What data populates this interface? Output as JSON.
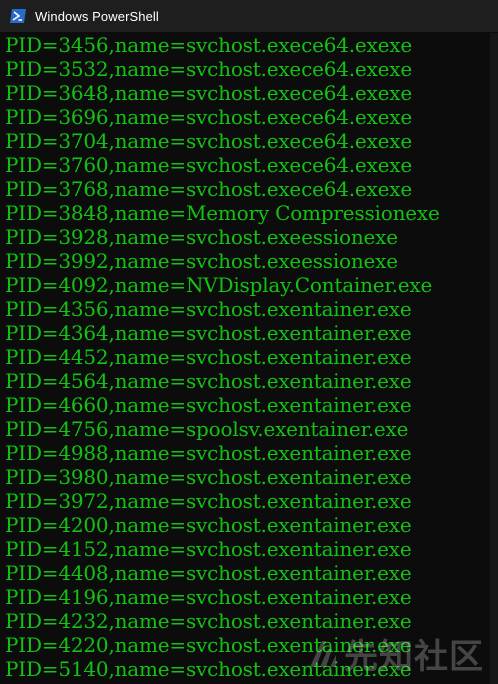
{
  "window": {
    "title": "Windows PowerShell",
    "icon": "powershell-icon"
  },
  "colors": {
    "console_background": "#0c0c0c",
    "console_text": "#13c313",
    "titlebar_background": "#1e1e1e"
  },
  "console": {
    "lines": [
      "PID=3456,name=svchost.exece64.exexe",
      "PID=3532,name=svchost.exece64.exexe",
      "PID=3648,name=svchost.exece64.exexe",
      "PID=3696,name=svchost.exece64.exexe",
      "PID=3704,name=svchost.exece64.exexe",
      "PID=3760,name=svchost.exece64.exexe",
      "PID=3768,name=svchost.exece64.exexe",
      "PID=3848,name=Memory Compressionexe",
      "PID=3928,name=svchost.exeessionexe",
      "PID=3992,name=svchost.exeessionexe",
      "PID=4092,name=NVDisplay.Container.exe",
      "PID=4356,name=svchost.exentainer.exe",
      "PID=4364,name=svchost.exentainer.exe",
      "PID=4452,name=svchost.exentainer.exe",
      "PID=4564,name=svchost.exentainer.exe",
      "PID=4660,name=svchost.exentainer.exe",
      "PID=4756,name=spoolsv.exentainer.exe",
      "PID=4988,name=svchost.exentainer.exe",
      "PID=3980,name=svchost.exentainer.exe",
      "PID=3972,name=svchost.exentainer.exe",
      "PID=4200,name=svchost.exentainer.exe",
      "PID=4152,name=svchost.exentainer.exe",
      "PID=4408,name=svchost.exentainer.exe",
      "PID=4196,name=svchost.exentainer.exe",
      "PID=4232,name=svchost.exentainer.exe",
      "PID=4220,name=svchost.exentainer.exe",
      "PID=5140,name=svchost.exentainer.exe"
    ]
  },
  "watermark": {
    "text": "先知社区",
    "icon": "xianzhi-logo-icon"
  }
}
